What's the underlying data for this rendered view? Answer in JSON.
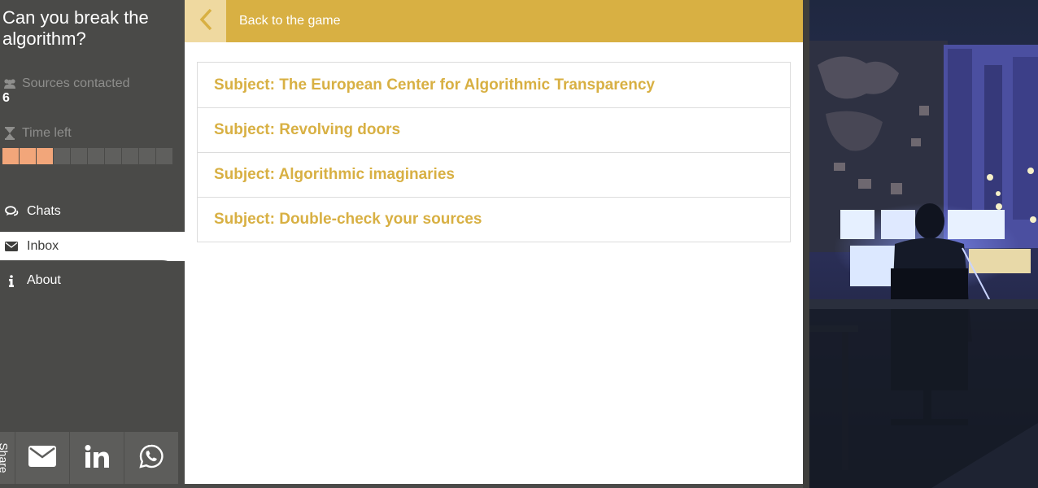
{
  "app": {
    "title": "Can you break the algorithm?"
  },
  "stats": {
    "sources_label": "Sources contacted",
    "sources_value": "6",
    "time_label": "Time left",
    "time_segments_total": 10,
    "time_segments_filled": 3
  },
  "nav": {
    "chats": "Chats",
    "inbox": "Inbox",
    "about": "About"
  },
  "share": {
    "label": "Share"
  },
  "topbar": {
    "back_label": "Back to the game"
  },
  "inbox": {
    "messages": [
      {
        "subject": "Subject: The European Center for Algorithmic Transparency"
      },
      {
        "subject": "Subject: Revolving doors"
      },
      {
        "subject": "Subject: Algorithmic imaginaries"
      },
      {
        "subject": "Subject: Double-check your sources"
      }
    ]
  },
  "colors": {
    "accent": "#d8b043",
    "accent_light": "#efd9a0",
    "sidebar": "#4a4a48",
    "time_filled": "#f2a67a",
    "time_empty": "#5f5f5d"
  }
}
